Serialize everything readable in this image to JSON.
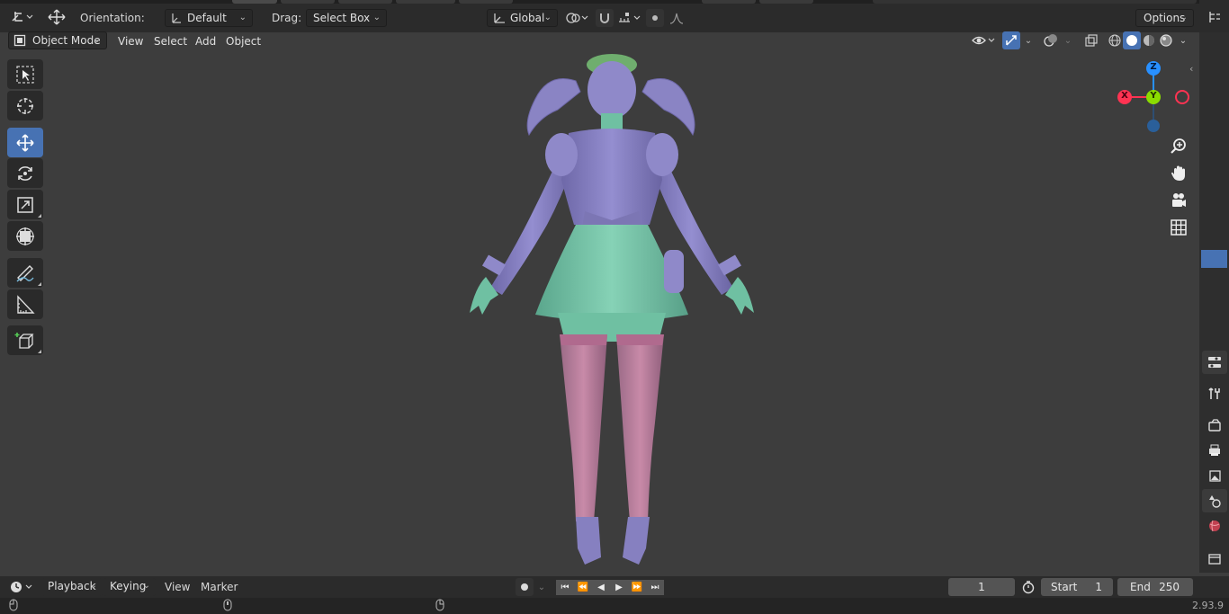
{
  "header": {
    "orientation_label": "Orientation:",
    "orientation_value": "Default",
    "drag_label": "Drag:",
    "drag_value": "Select Box",
    "transform_space": "Global",
    "options_label": "Options"
  },
  "viewport_header": {
    "mode": "Object Mode",
    "menus": [
      "View",
      "Select",
      "Add",
      "Object"
    ]
  },
  "tools": [
    {
      "name": "select-box-tool",
      "icon": "select-box-icon",
      "active": false
    },
    {
      "name": "cursor-tool",
      "icon": "cursor-icon",
      "active": false
    },
    {
      "name": "move-tool",
      "icon": "move-icon",
      "active": true
    },
    {
      "name": "rotate-tool",
      "icon": "rotate-icon",
      "active": false
    },
    {
      "name": "scale-tool",
      "icon": "scale-icon",
      "active": false
    },
    {
      "name": "transform-tool",
      "icon": "transform-icon",
      "active": false
    },
    {
      "name": "annotate-tool",
      "icon": "annotate-icon",
      "active": false
    },
    {
      "name": "measure-tool",
      "icon": "measure-icon",
      "active": false
    },
    {
      "name": "add-cube-tool",
      "icon": "add-cube-icon",
      "active": false
    }
  ],
  "gizmo": {
    "x_label": "X",
    "y_label": "Y",
    "z_label": "Z",
    "colors": {
      "x": "#ff3352",
      "y": "#8bdc00",
      "z": "#2890ff"
    }
  },
  "timeline": {
    "menus": [
      "Playback",
      "Keying",
      "View",
      "Marker"
    ],
    "current_frame": "1",
    "start_label": "Start",
    "start_value": "1",
    "end_label": "End",
    "end_value": "250"
  },
  "status": {
    "version": "2.93.9"
  },
  "colors": {
    "accent": "#4772b3",
    "viewport_bg": "#3d3d3d",
    "header_bg": "#2b2b2b",
    "character_hair": "#8a83c4",
    "character_dress": "#7f7ab8",
    "character_skirt": "#72c0a6",
    "character_legs": "#b77a9a"
  }
}
